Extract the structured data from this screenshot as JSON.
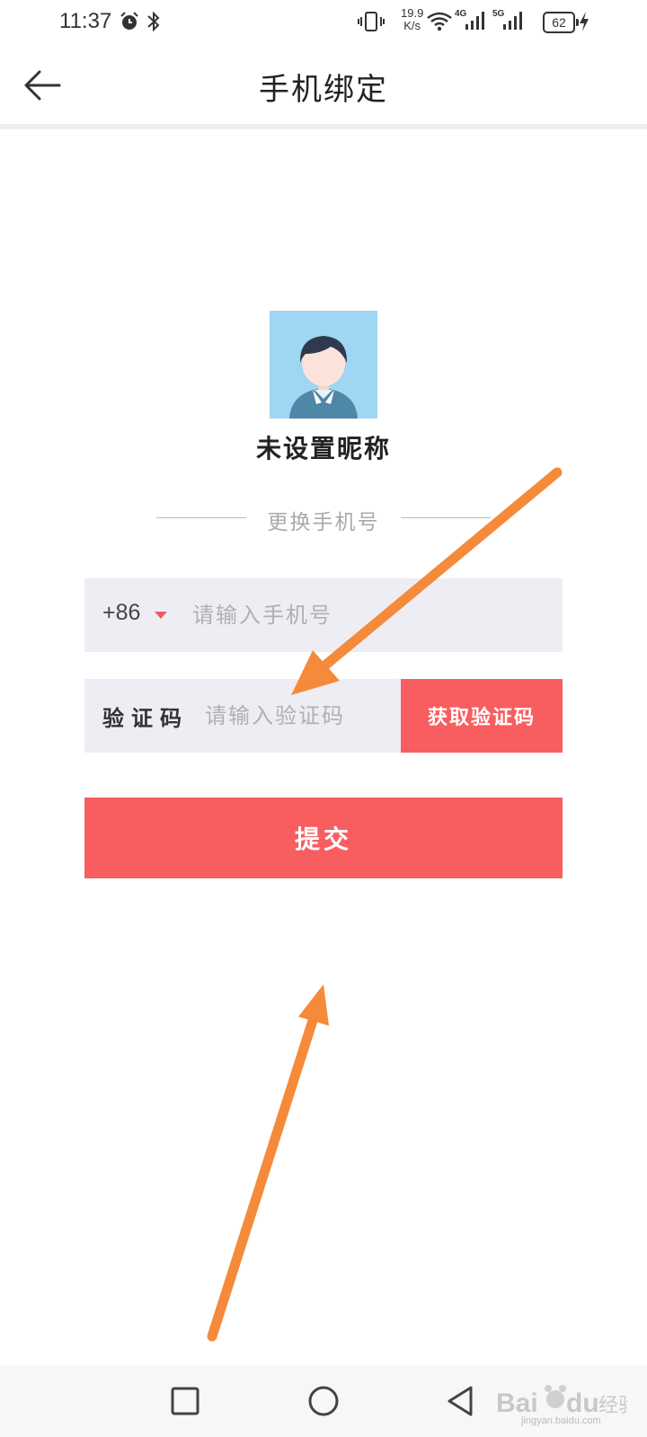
{
  "status_bar": {
    "time": "11:37",
    "net_speed_value": "19.9",
    "net_speed_unit": "K/s",
    "network_1": "4G",
    "network_2": "5G",
    "battery": "62",
    "icons": [
      "alarm-icon",
      "bluetooth-icon",
      "vibrate-icon",
      "wifi-icon",
      "signal-icon",
      "signal-icon",
      "charging-icon"
    ]
  },
  "header": {
    "title": "手机绑定",
    "back_icon": "arrow-left-icon"
  },
  "profile": {
    "avatar_icon": "default-avatar-icon",
    "nickname": "未设置昵称"
  },
  "section": {
    "divider_label": "更换手机号"
  },
  "phone_form": {
    "country_code": "+86",
    "phone_placeholder": "请输入手机号",
    "phone_value": "",
    "code_label": "验证码",
    "code_placeholder": "请输入验证码",
    "code_value": "",
    "get_code_label": "获取验证码",
    "submit_label": "提交"
  },
  "colors": {
    "accent": "#f85e60",
    "input_bg": "#eeedf3",
    "annotation_arrow": "#f58a3a",
    "avatar_bg": "#9fd6f2"
  },
  "nav_bar": {
    "icons": [
      "recent-apps-icon",
      "home-icon",
      "back-triangle-icon"
    ]
  },
  "watermark": {
    "text": "jingyan.baidu.com"
  }
}
